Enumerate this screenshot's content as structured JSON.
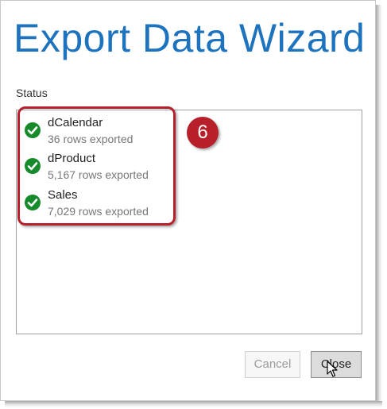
{
  "dialog": {
    "title": "Export Data Wizard",
    "status_label": "Status",
    "items": [
      {
        "name": "dCalendar",
        "detail": "36 rows exported",
        "state": "success",
        "icon": "check-circle-icon"
      },
      {
        "name": "dProduct",
        "detail": "5,167 rows exported",
        "state": "success",
        "icon": "check-circle-icon"
      },
      {
        "name": "Sales",
        "detail": "7,029 rows exported",
        "state": "success",
        "icon": "check-circle-icon"
      }
    ],
    "buttons": {
      "cancel_label": "Cancel",
      "close_label": "Close"
    }
  },
  "annotation": {
    "step_number": "6",
    "color": "#b7202a"
  },
  "colors": {
    "title": "#1e73be",
    "success": "#178a2c"
  }
}
